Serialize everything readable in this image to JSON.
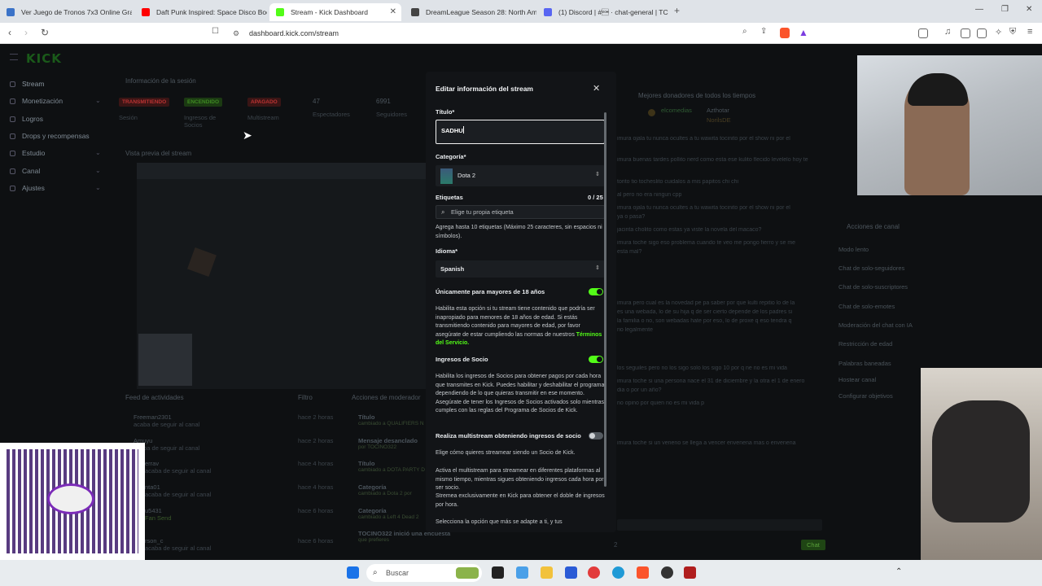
{
  "browser": {
    "tabs": [
      {
        "label": "Ver Juego de Tronos 7x3 Online Gra",
        "color": "#3b73c8"
      },
      {
        "label": "Daft Punk Inspired: Space Disco Boo",
        "color": "#ff0000"
      },
      {
        "label": "Stream - Kick Dashboard",
        "color": "#53fc18"
      },
      {
        "label": "DreamLeague Season 28: North Ame",
        "color": "#444444"
      },
      {
        "label": "(1) Discord | #\u0001 · chat-general | TC",
        "color": "#5865f2"
      }
    ],
    "url": "dashboard.kick.com/stream"
  },
  "sidebar": {
    "logo": "KICK",
    "items": [
      {
        "label": "Stream",
        "chevron": false,
        "active": true
      },
      {
        "label": "Monetización",
        "chevron": true
      },
      {
        "label": "Logros",
        "chevron": false
      },
      {
        "label": "Drops y recompensas",
        "chevron": false
      },
      {
        "label": "Estudio",
        "chevron": true
      },
      {
        "label": "Canal",
        "chevron": true
      },
      {
        "label": "Ajustes",
        "chevron": true
      }
    ]
  },
  "session": {
    "title": "Información de la sesión",
    "stats": [
      {
        "badge": "TRANSMITIENDO",
        "label": "Sesión",
        "color": "#e23b3b"
      },
      {
        "badge": "ENCENDIDO",
        "label": "Ingresos de Socios",
        "color": "#53fc18"
      },
      {
        "badge": "APAGADO",
        "label": "Multistream",
        "color": "#e23b3b"
      },
      {
        "value": "47",
        "label": "Espectadores"
      },
      {
        "value": "6991",
        "label": "Seguidores"
      }
    ],
    "preview_title": "Vista previa del stream"
  },
  "feed": {
    "title": "Feed de actividades",
    "filter": "Filtro",
    "rows": [
      {
        "name": "Freeman2301",
        "text": "acaba de seguir al canal",
        "time": "hace 2 horas"
      },
      {
        "name": "Amuyu",
        "text": "acaba de seguir al canal",
        "time": "hace 2 horas"
      },
      {
        "name": "errav",
        "text": "acaba de seguir al canal",
        "time": "hace 4 horas"
      },
      {
        "name": "nta01",
        "text": "acaba de seguir al canal",
        "time": "hace 4 horas"
      },
      {
        "name": "u5431",
        "text": "Fan Send",
        "time": "hace 6 horas"
      },
      {
        "name": "rson_c",
        "text": "acaba de seguir al canal",
        "time": "hace 6 horas"
      }
    ]
  },
  "modactions": {
    "title": "Acciones de moderador",
    "rows": [
      {
        "title": "Título",
        "sub": "cambiado a QUALIFIERS N"
      },
      {
        "title": "Mensaje desanclado",
        "sub": "por TOCINO322"
      },
      {
        "title": "Título",
        "sub": "cambiado a DOTA PARTY D"
      },
      {
        "title": "Categoría",
        "sub": "cambiado a Dota 2 por"
      },
      {
        "title": "Categoría",
        "sub": "cambiado a Left 4 Dead 2"
      },
      {
        "title": "TOCINO322 inició una encuesta",
        "sub": "que prefieres"
      }
    ]
  },
  "chat": {
    "donors_title": "Mejores donadores de todos los tiempos",
    "donors": [
      "elcomedias",
      "Azthotar",
      "NorilsDE"
    ],
    "lines": [
      "imura ojala tu nunca ocultes a tu wawita tocinito por el show ni por el",
      "imura buenas tardes pollito nerd como esta ese kulito flecido levelelo hoy te",
      "torito tio tocheslito cuidalos a mis papitos chi chi",
      "al pero no era ningun cpp",
      "imura ojala tu nunca ocultes a tu wawita tocinito por el show ni por el",
      "ya o pasa?",
      "jacinta cholito como estas ya viste la novela del macaco?",
      "imura toche sigo eso problema cuando te veo me pongo fierro y se me",
      "esta mal?",
      "imura pero cual es la novedad pe pa saber por que kulti repitio lo de la",
      "es una webada, lo de su hija q de ser cierto depende de los padres si",
      "la familia o no, son webadas hate por eso, lo de proxe q eso tendra q",
      "rio legalmente",
      "los seguiles pero no los sigo solo los sigo 10 por q ne no es mi vida",
      "imura toche si una persona nace el 31 de diciembre y la otra el 1 de enero",
      "dia o por un año?",
      "no opino por quien no es mi vida p",
      "imura toche si un veneno se llega a vencer envenena mas o envenena"
    ],
    "send": "Chat",
    "viewers": "2"
  },
  "channel_actions": {
    "title": "Acciones de canal",
    "items": [
      "Modo lento",
      "Chat de solo-seguidores",
      "Chat de solo-suscriptores",
      "Chat de solo-emotes",
      "Moderación del chat con IA",
      "Restricción de edad",
      "Palabras baneadas",
      "Hostear canal",
      "Configurar objetivos"
    ]
  },
  "modal": {
    "title": "Editar información del stream",
    "title_label": "Título*",
    "title_value": "SADHU",
    "category_label": "Categoría*",
    "category_value": "Dota 2",
    "tags_label": "Etiquetas",
    "tags_count": "0 / 25",
    "tags_placeholder": "Elige tu propia etiqueta",
    "tags_help": "Agrega hasta 10 etiquetas (Máximo 25 caracteres, sin espacios ni símbolos).",
    "language_label": "Idioma*",
    "language_value": "Spanish",
    "mature_label": "Únicamente para mayores de 18 años",
    "mature_on": true,
    "mature_help": "Habilita esta opción si tu stream tiene contenido que podría ser inapropiado para menores de 18 años de edad. Si estás transmitiendo contenido para mayores de edad, por favor asegúrate de estar cumpliendo las normas de nuestros ",
    "mature_link": "Términos del Servicio.",
    "partner_label": "Ingresos de Socio",
    "partner_on": true,
    "partner_help": "Habilita los ingresos de Socios para obtener pagos por cada hora que transmites en Kick. Puedes habilitar y deshabilitar el programa dependiendo de lo que quieras transmitir en ese momento. Asegúrate de tener los Ingresos de Socios activados solo mientras cumples con las reglas del Programa de Socios de Kick.",
    "multistream_label": "Realiza multistream obteniendo ingresos de socio",
    "multistream_on": false,
    "multistream_help1": "Elige cómo quieres streamear siendo un Socio de Kick.",
    "multistream_help2": "Activa el multistream para streamear en diferentes plataformas al mismo tiempo, mientras sigues obteniendo ingresos cada hora por ser socio.",
    "multistream_help3": "Stremea exclusivamente en Kick para obtener el doble de ingresos por hora.",
    "multistream_help4": "Selecciona la opción que más se adapte a ti, y tus"
  },
  "taskbar": {
    "search": "Buscar"
  }
}
